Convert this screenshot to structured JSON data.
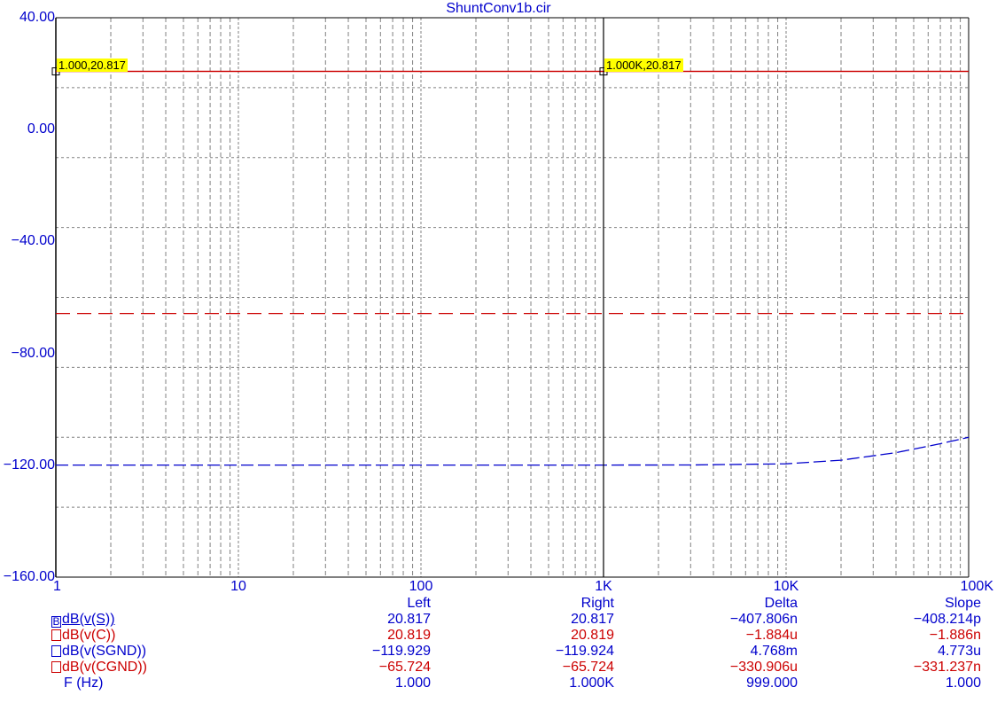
{
  "chart_data": {
    "type": "line",
    "title": "ShuntConv1b.cir",
    "x_scale": "log",
    "xlim": [
      1,
      100000
    ],
    "ylim": [
      -160,
      40
    ],
    "x_tick_labels": [
      "1",
      "10",
      "100",
      "1K",
      "10K",
      "100K"
    ],
    "y_tick_labels": [
      "40.00",
      "0.00",
      "-40.00",
      "-80.00",
      "-120.00",
      "-160.00"
    ],
    "y_ticks": [
      40,
      0,
      -40,
      -80,
      -120,
      -160
    ],
    "grid": true,
    "series": [
      {
        "name": "dB(v(S))",
        "color": "#cc0000",
        "style": "solid",
        "x": [
          1,
          10,
          100,
          1000,
          10000,
          100000
        ],
        "y": [
          20.817,
          20.817,
          20.817,
          20.817,
          20.817,
          20.817
        ]
      },
      {
        "name": "dB(v(C))",
        "color": "#cc0000",
        "style": "solid",
        "x": [
          1,
          10,
          100,
          1000,
          10000,
          100000
        ],
        "y": [
          20.819,
          20.819,
          20.819,
          20.819,
          20.819,
          20.819
        ]
      },
      {
        "name": "dB(v(SGND))",
        "color": "#0000cc",
        "style": "dashed",
        "x": [
          1,
          10,
          100,
          1000,
          3000,
          10000,
          20000,
          40000,
          70000,
          100000
        ],
        "y": [
          -119.929,
          -119.929,
          -119.928,
          -119.924,
          -119.89,
          -119.5,
          -118.2,
          -115.5,
          -112.3,
          -110
        ]
      },
      {
        "name": "dB(v(CGND))",
        "color": "#cc0000",
        "style": "dashed",
        "x": [
          1,
          10,
          100,
          1000,
          10000,
          100000
        ],
        "y": [
          -65.724,
          -65.724,
          -65.724,
          -65.724,
          -65.724,
          -65.724
        ]
      }
    ],
    "cursors": [
      {
        "x": 1,
        "y": 20.817,
        "label": "1.000,20.817"
      },
      {
        "x": 1000,
        "y": 20.817,
        "label": "1.000K,20.817"
      }
    ]
  },
  "readout": {
    "headers": [
      "Left",
      "Right",
      "Delta",
      "Slope"
    ],
    "rows": [
      {
        "box": "B",
        "name": "dB(v(S))",
        "color": "#0000cc",
        "left": "20.817",
        "right": "20.817",
        "delta": "-407.806n",
        "slope": "-408.214p"
      },
      {
        "box": "",
        "name": "dB(v(C))",
        "color": "#cc0000",
        "left": "20.819",
        "right": "20.819",
        "delta": "-1.884u",
        "slope": "-1.886n"
      },
      {
        "box": "",
        "name": "dB(v(SGND))",
        "color": "#0000cc",
        "left": "-119.929",
        "right": "-119.924",
        "delta": "4.768m",
        "slope": "4.773u"
      },
      {
        "box": "",
        "name": "dB(v(CGND))",
        "color": "#cc0000",
        "left": "-65.724",
        "right": "-65.724",
        "delta": "-330.906u",
        "slope": "-331.237n"
      }
    ],
    "freq_row": {
      "name": "F (Hz)",
      "left": "1.000",
      "right": "1.000K",
      "delta": "999.000",
      "slope": "1.000"
    }
  }
}
